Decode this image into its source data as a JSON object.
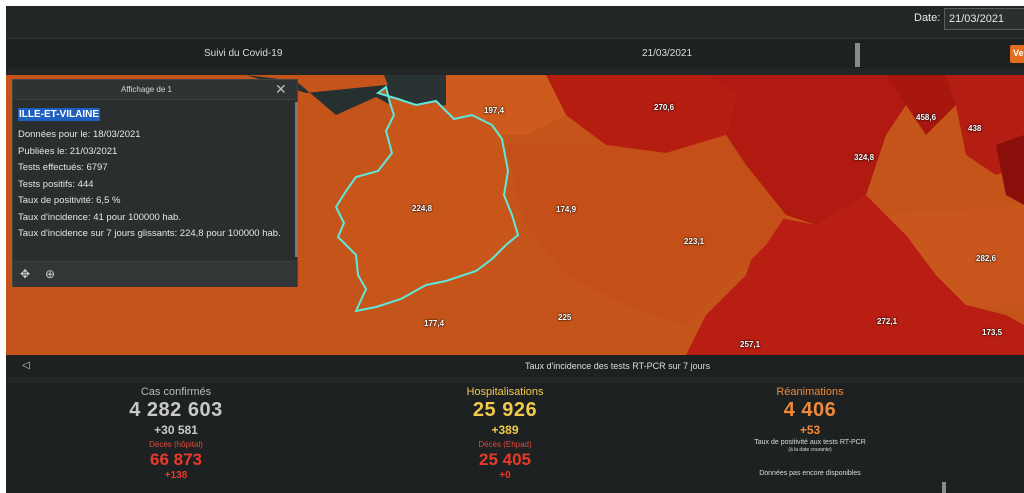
{
  "datebar": {
    "label": "Date:",
    "value": "21/03/2021"
  },
  "header": {
    "title": "Suivi du Covid-19",
    "date": "21/03/2021",
    "button_label": "Ve"
  },
  "map": {
    "labels": [
      "197,4",
      "270,6",
      "458,6",
      "438",
      "324,8",
      "224,8",
      "174,9",
      "223,1",
      "282,6",
      "177,4",
      "225",
      "257,1",
      "272,1",
      "173,5"
    ],
    "footer_text": "Taux d'incidence des tests RT-PCR sur 7 jours"
  },
  "popup": {
    "header_title": "Affichage de 1",
    "name": "ILLE-ET-VILAINE",
    "lines": [
      "Données pour le: 18/03/2021",
      "Publiées le: 21/03/2021",
      "Tests effectués: 6797",
      "Tests positifs: 444",
      "Taux de positivité: 6,5 %",
      "Taux d'incidence: 41 pour 100000 hab.",
      "Taux d'incidence sur 7 jours glissants: 224,8 pour 100000 hab."
    ]
  },
  "stats": {
    "cas": {
      "title": "Cas confirmés",
      "value": "4 282 603",
      "delta": "+30 581",
      "sub_label": "Décès (hôpital)",
      "sub_value": "66 873",
      "sub_delta": "+138"
    },
    "hosp": {
      "title": "Hospitalisations",
      "value": "25 926",
      "delta": "+389",
      "sub_label": "Décès (Ehpad)",
      "sub_value": "25 405",
      "sub_delta": "+0"
    },
    "rea": {
      "title": "Réanimations",
      "value": "4 406",
      "delta": "+53",
      "note": "Taux de positivité aux tests RT-PCR",
      "note_small": "(à la date courante)",
      "pending": "Données pas encore disponibles"
    }
  },
  "colors": {
    "cas": "#c9c9c9",
    "hosp": "#f2c94c",
    "rea": "#f08a3a",
    "deaths": "#e83a2b",
    "highlight": "#1f5fbf",
    "outline": "#5ee8dc"
  }
}
